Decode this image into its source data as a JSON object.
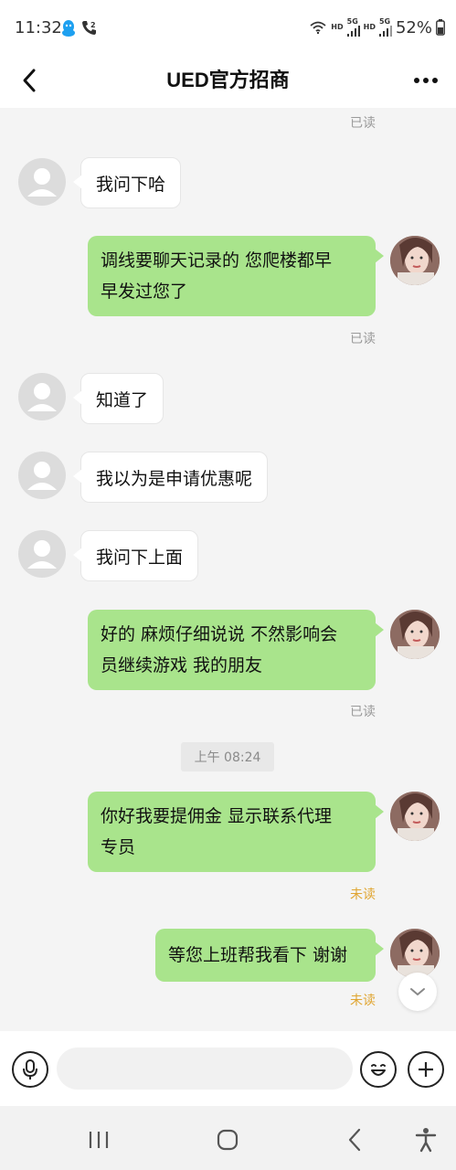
{
  "status_bar": {
    "time": "11:32",
    "network_tag_1": "HD",
    "network_gen_1": "5G",
    "network_tag_2": "HD",
    "network_gen_2": "5G",
    "battery": "52%",
    "icons": [
      "qq-icon",
      "call-forward-icon",
      "wifi-icon",
      "signal-icon",
      "signal-icon",
      "battery-icon"
    ]
  },
  "header": {
    "title": "UED官方招商",
    "back_icon": "chevron-left-icon",
    "more_icon": "more-dots-icon"
  },
  "messages": [
    {
      "type": "receipt",
      "text": "已读"
    },
    {
      "type": "incoming",
      "text": "我问下哈"
    },
    {
      "type": "outgoing",
      "lines": [
        "调线要聊天记录的 您爬楼都早",
        "早发过您了"
      ],
      "receipt": "已读"
    },
    {
      "type": "incoming",
      "text": "知道了"
    },
    {
      "type": "incoming",
      "text": "我以为是申请优惠呢"
    },
    {
      "type": "incoming",
      "text": "我问下上面"
    },
    {
      "type": "outgoing",
      "lines": [
        "好的 麻烦仔细说说 不然影响会",
        "员继续游戏 我的朋友"
      ],
      "receipt": "已读"
    },
    {
      "type": "timestamp",
      "text": "上午 08:24"
    },
    {
      "type": "outgoing",
      "lines": [
        "你好我要提佣金  显示联系代理",
        "专员"
      ],
      "receipt": "未读"
    },
    {
      "type": "outgoing",
      "lines": [
        "等您上班帮我看下 谢谢"
      ],
      "receipt": "未读"
    }
  ],
  "colors": {
    "outgoing_bubble": "#a9e48c",
    "incoming_bubble": "#ffffff",
    "chat_background": "#f4f4f4",
    "read_receipt": "#9a9a9a",
    "unread_receipt": "#e0a531"
  },
  "input_bar": {
    "placeholder": "",
    "mic_icon": "microphone-icon",
    "emoji_icon": "emoji-icon",
    "plus_icon": "plus-icon"
  },
  "nav_bar": {
    "buttons": [
      "recent-apps-icon",
      "home-icon",
      "back-icon",
      "accessibility-icon"
    ]
  }
}
